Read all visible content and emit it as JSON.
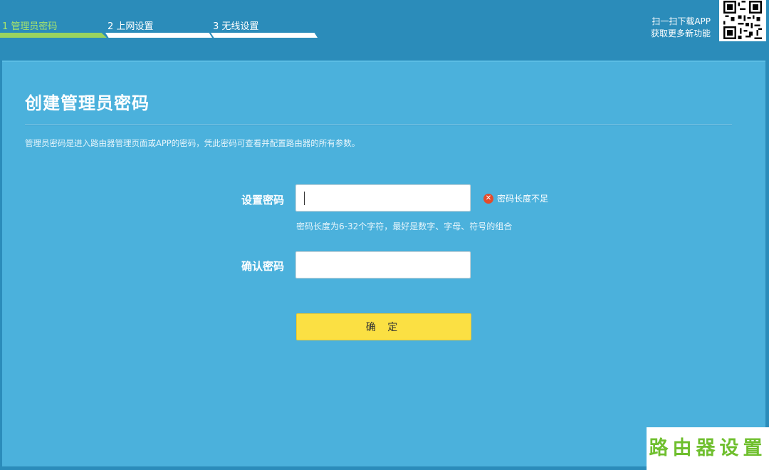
{
  "steps": [
    {
      "label": "1 管理员密码",
      "active": true
    },
    {
      "label": "2 上网设置",
      "active": false
    },
    {
      "label": "3 无线设置",
      "active": false
    }
  ],
  "app_promo": {
    "line1": "扫一扫下载APP",
    "line2": "获取更多新功能"
  },
  "panel": {
    "title": "创建管理员密码",
    "description": "管理员密码是进入路由器管理页面或APP的密码，凭此密码可查看并配置路由器的所有参数。"
  },
  "form": {
    "password_label": "设置密码",
    "password_value": "",
    "error_text": "密码长度不足",
    "hint": "密码长度为6-32个字符，最好是数字、字母、符号的组合",
    "confirm_label": "确认密码",
    "confirm_value": "",
    "submit_label": "确 定"
  },
  "watermark": "路由器设置",
  "colors": {
    "background": "#2b8cba",
    "panel": "#4bb1dc",
    "active_step": "#9ad35f",
    "button": "#fbe043",
    "error": "#e34c2c",
    "watermark_text": "#6fbf2e"
  }
}
